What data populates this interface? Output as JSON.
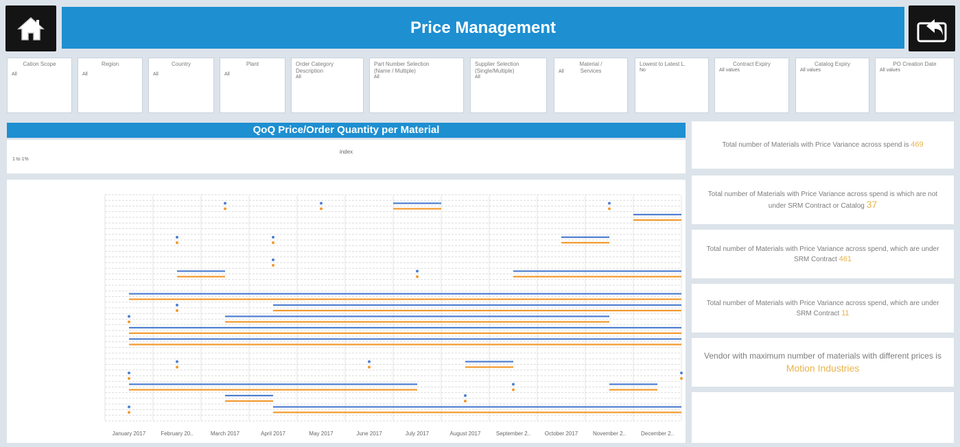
{
  "header": {
    "title": "Price Management"
  },
  "filters": [
    {
      "label": "Cation Scope",
      "value": "All"
    },
    {
      "label": "Region",
      "value": "All"
    },
    {
      "label": "Country",
      "value": "All"
    },
    {
      "label": "Plant",
      "value": "All"
    },
    {
      "label": "Order Category\nDescription",
      "value": "All"
    },
    {
      "label": "Part Number Selection\n(Name / Multiple)",
      "value": "All"
    },
    {
      "label": "Supplier Selection\n(Single/Multiple)",
      "value": "All"
    },
    {
      "label": "Material /\nServices",
      "value": "All"
    },
    {
      "label": "Lowest to Latest L.",
      "value": "No"
    },
    {
      "label": "Contract Expiry",
      "value": "All values"
    },
    {
      "label": "Catalog Expiry",
      "value": "All values"
    },
    {
      "label": "PO Creation Date",
      "value": "All values"
    }
  ],
  "chart": {
    "title": "QoQ Price/Order Quantity per Material",
    "legend_title": "index",
    "legend_item": "1 to 1%"
  },
  "kpis": [
    {
      "text": "Total number of Materials with Price Variance across spend is",
      "value": "469"
    },
    {
      "text": "Total number of Materials with Price Variance across spend is which are not under SRM Contract or Catalog",
      "value": "37"
    },
    {
      "text": "Total number of Materials with Price Variance across spend, which are under SRM Contract",
      "value": "461"
    },
    {
      "text": "Total number of Materials with Price Variance across spend, which are under SRM Contract",
      "value": "11"
    },
    {
      "text": "Vendor with maximum number of materials with different prices is",
      "value": "Motion Industries"
    }
  ],
  "colors": {
    "accent": "#1e8fd1",
    "kpi_value": "#e8b44a",
    "series_blue": "#4f7fd0",
    "series_orange": "#f29a2e"
  },
  "icons": {
    "home": "home-icon",
    "back": "back-arrow-icon"
  },
  "chart_data": {
    "type": "line",
    "x": [
      "January 2017",
      "February 20..",
      "March 2017",
      "April 2017",
      "May 2017",
      "June 2017",
      "July 2017",
      "August 2017",
      "September 2..",
      "October 2017",
      "November 2..",
      "December 2.."
    ],
    "series": [
      {
        "color": "#4f7fd0",
        "rows": [
          {
            "row": 1,
            "segments": [
              [
                6,
                7
              ]
            ],
            "dots": [
              2.5,
              4.5,
              10.5
            ]
          },
          {
            "row": 2,
            "segments": [
              [
                11,
                12
              ]
            ]
          },
          {
            "row": 4,
            "segments": [
              [
                9.5,
                10.5
              ]
            ],
            "dots": [
              1.5,
              3.5
            ]
          },
          {
            "row": 6,
            "dots": [
              3.5
            ]
          },
          {
            "row": 7,
            "segments": [
              [
                1.5,
                2.5
              ],
              [
                8.5,
                12
              ]
            ],
            "dots": [
              6.5
            ]
          },
          {
            "row": 9,
            "segments": [
              [
                0.5,
                12
              ]
            ]
          },
          {
            "row": 10,
            "segments": [
              [
                3.5,
                12
              ]
            ],
            "dots": [
              1.5
            ]
          },
          {
            "row": 11,
            "segments": [
              [
                2.5,
                10.5
              ]
            ],
            "dots": [
              0.5
            ]
          },
          {
            "row": 12,
            "segments": [
              [
                0.5,
                12
              ]
            ]
          },
          {
            "row": 13,
            "segments": [
              [
                0.5,
                12
              ]
            ]
          },
          {
            "row": 15,
            "segments": [
              [
                7.5,
                8.5
              ]
            ],
            "dots": [
              1.5,
              5.5
            ]
          },
          {
            "row": 16,
            "dots": [
              0.5,
              12
            ]
          },
          {
            "row": 17,
            "segments": [
              [
                0.5,
                6.5
              ],
              [
                10.5,
                11.5
              ]
            ],
            "dots": [
              8.5
            ]
          },
          {
            "row": 18,
            "segments": [
              [
                2.5,
                3.5
              ]
            ],
            "dots": [
              7.5
            ]
          },
          {
            "row": 19,
            "segments": [
              [
                3.5,
                12
              ]
            ],
            "dots": [
              0.5
            ]
          }
        ]
      },
      {
        "color": "#f29a2e",
        "rows": [
          {
            "row": 1,
            "segments": [
              [
                6,
                7
              ]
            ],
            "dots": [
              2.5,
              4.5,
              10.5
            ]
          },
          {
            "row": 2,
            "segments": [
              [
                11,
                12
              ]
            ]
          },
          {
            "row": 4,
            "segments": [
              [
                9.5,
                10.5
              ]
            ],
            "dots": [
              1.5,
              3.5
            ]
          },
          {
            "row": 6,
            "dots": [
              3.5
            ]
          },
          {
            "row": 7,
            "segments": [
              [
                1.5,
                2.5
              ],
              [
                8.5,
                12
              ]
            ],
            "dots": [
              6.5
            ]
          },
          {
            "row": 9,
            "segments": [
              [
                0.5,
                12
              ]
            ]
          },
          {
            "row": 10,
            "segments": [
              [
                3.5,
                12
              ]
            ],
            "dots": [
              1.5
            ]
          },
          {
            "row": 11,
            "segments": [
              [
                2.5,
                10.5
              ]
            ],
            "dots": [
              0.5
            ]
          },
          {
            "row": 12,
            "segments": [
              [
                0.5,
                12
              ]
            ]
          },
          {
            "row": 13,
            "segments": [
              [
                0.5,
                12
              ]
            ]
          },
          {
            "row": 15,
            "segments": [
              [
                7.5,
                8.5
              ]
            ],
            "dots": [
              1.5,
              5.5
            ]
          },
          {
            "row": 16,
            "dots": [
              0.5,
              12
            ]
          },
          {
            "row": 17,
            "segments": [
              [
                0.5,
                6.5
              ],
              [
                10.5,
                11.5
              ]
            ],
            "dots": [
              8.5
            ]
          },
          {
            "row": 18,
            "segments": [
              [
                2.5,
                3.5
              ]
            ],
            "dots": [
              7.5
            ]
          },
          {
            "row": 19,
            "segments": [
              [
                3.5,
                12
              ]
            ],
            "dots": [
              0.5
            ]
          }
        ]
      }
    ],
    "row_count": 20,
    "grid": true
  }
}
